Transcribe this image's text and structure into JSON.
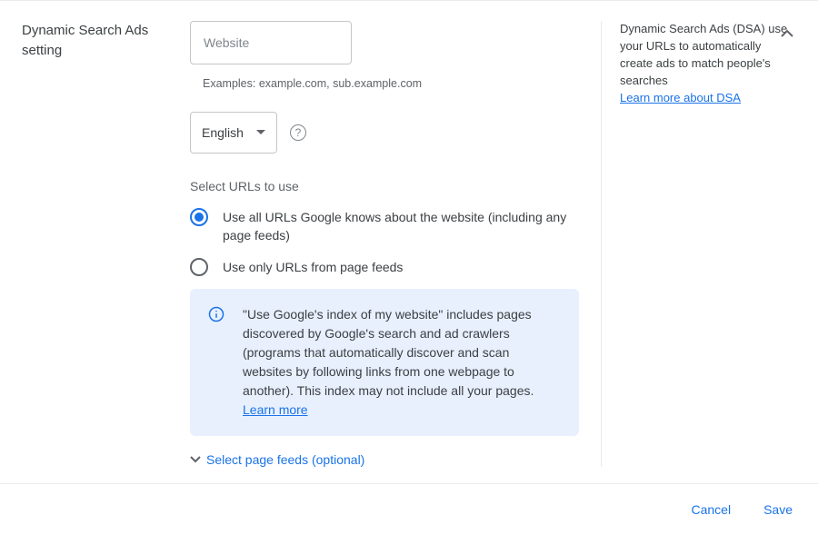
{
  "section_title": "Dynamic Search Ads setting",
  "website": {
    "placeholder": "Website",
    "helper": "Examples: example.com, sub.example.com"
  },
  "language": {
    "selected": "English"
  },
  "urls": {
    "label": "Select URLs to use",
    "options": [
      "Use all URLs Google knows about the website (including any page feeds)",
      "Use only URLs from page feeds"
    ]
  },
  "info": {
    "text": "\"Use Google's index of my website\" includes pages discovered by Google's search and ad crawlers (programs that automatically discover and scan websites by following links from one webpage to another). This index may not include all your pages.",
    "link_label": "Learn more"
  },
  "expand_label": "Select page feeds (optional)",
  "side": {
    "text": "Dynamic Search Ads (DSA) use your URLs to automatically create ads to match people's searches",
    "link_label": "Learn more about DSA"
  },
  "footer": {
    "cancel": "Cancel",
    "save": "Save"
  }
}
